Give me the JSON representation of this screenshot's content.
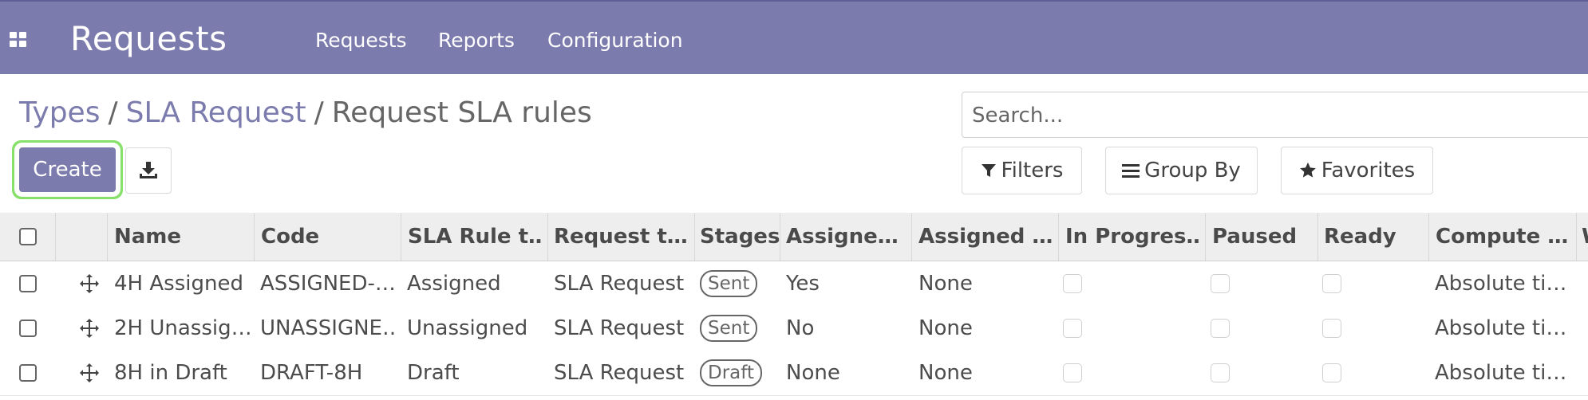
{
  "navbar": {
    "app_title": "Requests",
    "menu": [
      "Requests",
      "Reports",
      "Configuration"
    ],
    "apps_icon": "grid-icon"
  },
  "breadcrumb": {
    "items": [
      "Types",
      "SLA Request"
    ],
    "separator": "/",
    "current": "Request SLA rules"
  },
  "toolbar": {
    "create_label": "Create",
    "export_icon": "download-icon"
  },
  "search": {
    "placeholder": "Search...",
    "filters_label": "Filters",
    "group_by_label": "Group By",
    "favorites_label": "Favorites"
  },
  "table": {
    "columns": [
      "Name",
      "Code",
      "SLA Rule t…",
      "Request t…",
      "Stages",
      "Assigne…",
      "Assigned …",
      "In Progres…",
      "Paused",
      "Ready",
      "Compute …",
      "W"
    ],
    "rows": [
      {
        "name": "4H Assigned",
        "code": "ASSIGNED-…",
        "rule_type": "Assigned",
        "request_type": "SLA Request",
        "stage": "Sent",
        "assigned": "Yes",
        "assigned_to": "None",
        "compute": "Absolute ti…"
      },
      {
        "name": "2H Unassig…",
        "code": "UNASSIGNE…",
        "rule_type": "Unassigned",
        "request_type": "SLA Request",
        "stage": "Sent",
        "assigned": "No",
        "assigned_to": "None",
        "compute": "Absolute ti…"
      },
      {
        "name": "8H in Draft",
        "code": "DRAFT-8H",
        "rule_type": "Draft",
        "request_type": "SLA Request",
        "stage": "Draft",
        "assigned": "None",
        "assigned_to": "None",
        "compute": "Absolute ti…"
      }
    ]
  },
  "colors": {
    "brand": "#7c7bad",
    "highlight": "#86e06a"
  }
}
